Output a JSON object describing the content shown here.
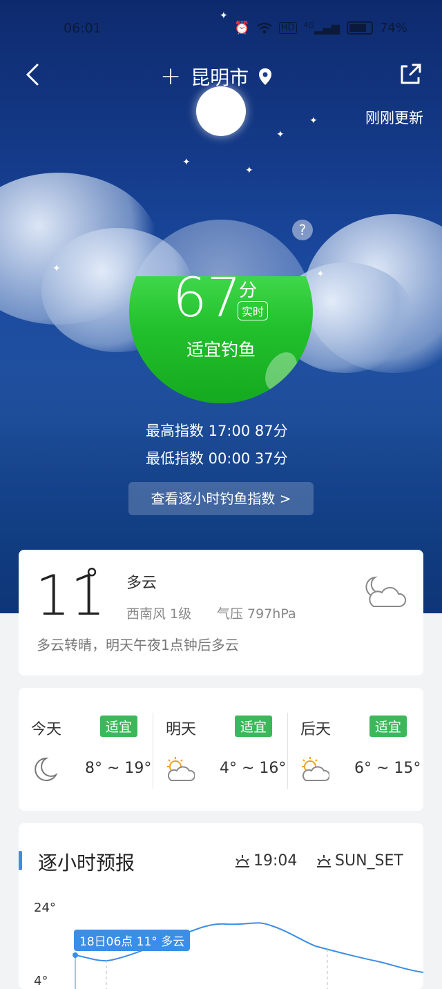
{
  "status_bar": {
    "time": "06:01",
    "battery": "74%",
    "network": "4G"
  },
  "header": {
    "city": "昆明市",
    "updated": "刚刚更新"
  },
  "fishing": {
    "score": "67",
    "unit": "分",
    "realtime": "实时",
    "suitability": "适宜钓鱼",
    "level_fraction": 0.67,
    "max_label": "最高指数  17:00  87分",
    "min_label": "最低指数  00:00  37分",
    "hourly_button": "查看逐小时钓鱼指数 >"
  },
  "current": {
    "temp": "11",
    "deg": "°",
    "condition": "多云",
    "wind": "西南风  1级",
    "pressure": "气压  797hPa",
    "desc": "多云转晴，明天午夜1点钟后多云",
    "icon": "cloudy-night-icon"
  },
  "forecast": [
    {
      "day": "今天",
      "tag": "适宜",
      "range": "8° ~ 19°",
      "icon": "moon-icon"
    },
    {
      "day": "明天",
      "tag": "适宜",
      "range": "4° ~ 16°",
      "icon": "partly-cloudy-icon"
    },
    {
      "day": "后天",
      "tag": "适宜",
      "range": "6° ~ 15°",
      "icon": "partly-cloudy-icon"
    }
  ],
  "hourly": {
    "title": "逐小时预报",
    "sunrise": "19:04",
    "sunset": "SUN_SET",
    "y_top": "24°",
    "y_bottom": "4°",
    "bubble": "18日06点 11° 多云"
  },
  "colors": {
    "accent": "#3a8ee6",
    "suitable": "#3cb85a",
    "fish_green": "#22c02c"
  }
}
